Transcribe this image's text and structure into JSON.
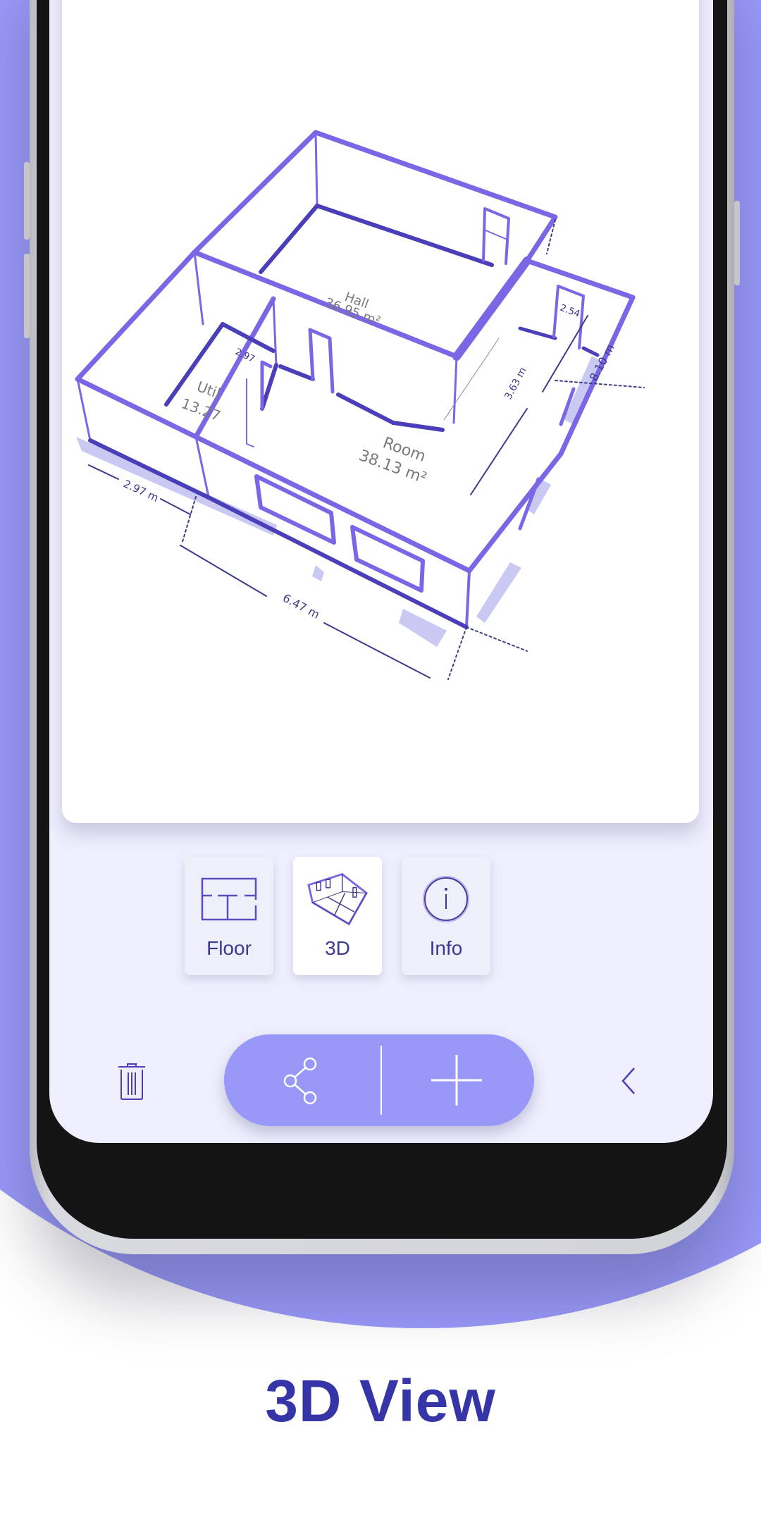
{
  "colors": {
    "accent": "#9898f8",
    "wall": "#7b66e6",
    "wall_dark": "#4a3fb8",
    "headline": "#3535a8",
    "screen_bg": "#eeeefd"
  },
  "plan": {
    "rooms": [
      {
        "name": "Hall",
        "area": "36.95 m²"
      },
      {
        "name": "Util",
        "area": "13.27"
      },
      {
        "name": "Room",
        "area": "38.13 m²"
      }
    ],
    "dimensions": {
      "util_width_outer": "2.97 m",
      "util_width_inner": "2.97",
      "front_length": "6.47 m",
      "side_length": "8.10 m",
      "room_depth": "3.63 m",
      "closet_width": "2.54"
    }
  },
  "view_modes": [
    {
      "id": "floor",
      "label": "Floor",
      "icon": "floor-plan-icon",
      "active": false
    },
    {
      "id": "3d",
      "label": "3D",
      "icon": "3d-room-icon",
      "active": true
    },
    {
      "id": "info",
      "label": "Info",
      "icon": "info-icon",
      "active": false
    }
  ],
  "toolbar": {
    "delete_icon": "trash-icon",
    "share_icon": "share-icon",
    "add_icon": "plus-icon",
    "back_icon": "chevron-left-icon"
  },
  "headline": "3D View"
}
